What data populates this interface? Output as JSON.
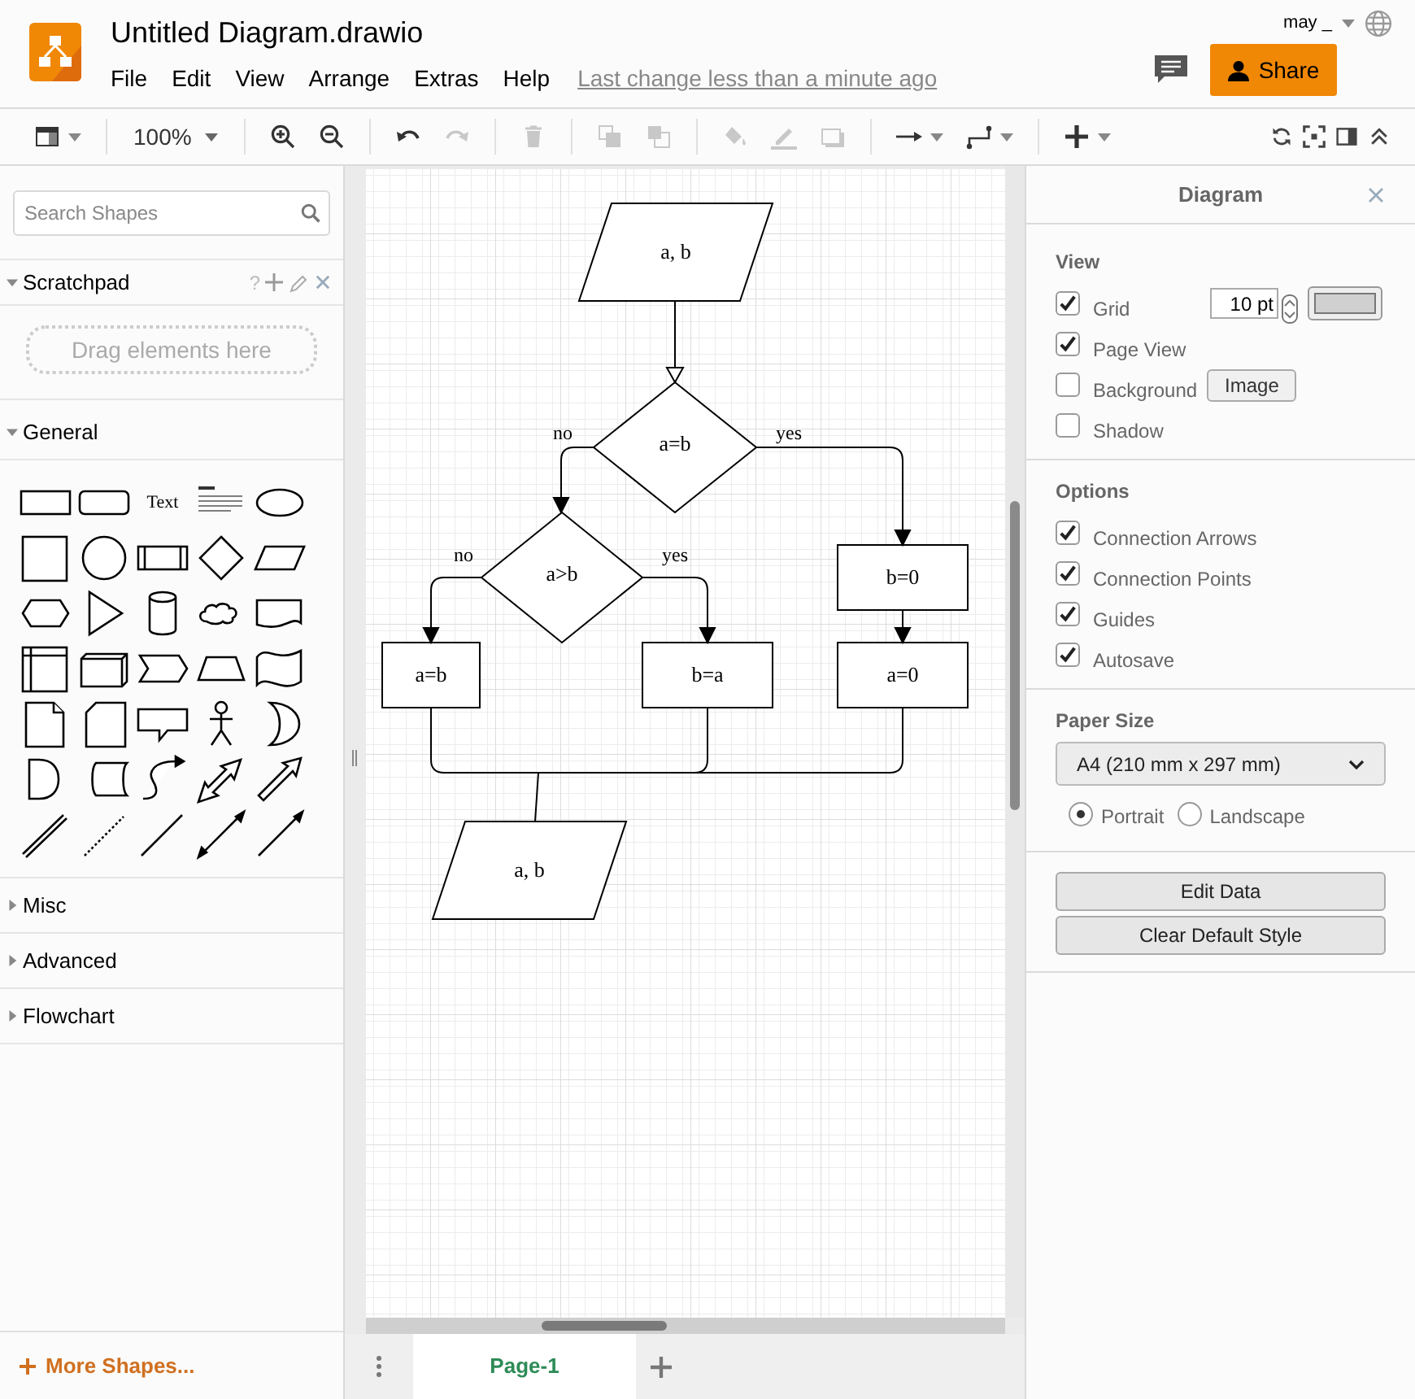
{
  "header": {
    "title": "Untitled Diagram.drawio",
    "menus": [
      "File",
      "Edit",
      "View",
      "Arrange",
      "Extras",
      "Help"
    ],
    "last_change": "Last change less than a minute ago",
    "user": "may _",
    "share": "Share"
  },
  "toolbar": {
    "groups": [
      [
        {
          "kind": "panels",
          "disabled": false
        }
      ],
      [
        {
          "kind": "zoom",
          "label": "100%",
          "disabled": false
        }
      ],
      [
        {
          "kind": "zoom-in",
          "disabled": false
        },
        {
          "kind": "zoom-out",
          "disabled": false
        }
      ],
      [
        {
          "kind": "undo",
          "disabled": false
        },
        {
          "kind": "redo",
          "disabled": true
        }
      ],
      [
        {
          "kind": "delete",
          "disabled": true
        }
      ],
      [
        {
          "kind": "to-front",
          "disabled": true
        },
        {
          "kind": "to-back",
          "disabled": true
        }
      ],
      [
        {
          "kind": "fill",
          "disabled": true
        },
        {
          "kind": "line-color",
          "disabled": true
        },
        {
          "kind": "shadow",
          "disabled": true
        }
      ],
      [
        {
          "kind": "connection",
          "disabled": false
        },
        {
          "kind": "waypoints",
          "disabled": false
        }
      ],
      [
        {
          "kind": "insert",
          "disabled": false
        }
      ]
    ],
    "right": [
      {
        "kind": "sync"
      },
      {
        "kind": "fullscreen"
      },
      {
        "kind": "format-panel"
      },
      {
        "kind": "collapse"
      }
    ]
  },
  "sidebar": {
    "search": {
      "placeholder": "Search Shapes"
    },
    "scratchpad": {
      "title": "Scratchpad",
      "expanded": true,
      "help": "?",
      "drop_hint": "Drag elements here"
    },
    "sections": [
      {
        "title": "General",
        "expanded": true,
        "shapes": [
          {
            "kind": "rectangle"
          },
          {
            "kind": "rounded-rectangle"
          },
          {
            "kind": "text",
            "label": "Text"
          },
          {
            "kind": "heading"
          },
          {
            "kind": "ellipse"
          },
          {
            "kind": "square"
          },
          {
            "kind": "circle"
          },
          {
            "kind": "process"
          },
          {
            "kind": "diamond"
          },
          {
            "kind": "parallelogram"
          },
          {
            "kind": "hexagon"
          },
          {
            "kind": "triangle"
          },
          {
            "kind": "cylinder"
          },
          {
            "kind": "cloud"
          },
          {
            "kind": "document"
          },
          {
            "kind": "internal-storage"
          },
          {
            "kind": "cube"
          },
          {
            "kind": "step"
          },
          {
            "kind": "trapezoid"
          },
          {
            "kind": "tape"
          },
          {
            "kind": "note"
          },
          {
            "kind": "card"
          },
          {
            "kind": "callout"
          },
          {
            "kind": "actor"
          },
          {
            "kind": "crescent"
          },
          {
            "kind": "delay"
          },
          {
            "kind": "data-storage"
          },
          {
            "kind": "curved-arrow"
          },
          {
            "kind": "double-arrow"
          },
          {
            "kind": "arrow"
          },
          {
            "kind": "link"
          },
          {
            "kind": "dashed-line"
          },
          {
            "kind": "line"
          },
          {
            "kind": "bidirectional-connector"
          },
          {
            "kind": "directional-connector"
          }
        ]
      },
      {
        "title": "Misc",
        "expanded": false
      },
      {
        "title": "Advanced",
        "expanded": false
      },
      {
        "title": "Flowchart",
        "expanded": false
      }
    ],
    "more_shapes": "More Shapes..."
  },
  "diagram": {
    "nodes": [
      {
        "kind": "data",
        "label": "a, b"
      },
      {
        "kind": "decision",
        "label": "a=b"
      },
      {
        "kind": "decision",
        "label": "a>b"
      },
      {
        "kind": "process",
        "label": "b=0"
      },
      {
        "kind": "process",
        "label": "a=b"
      },
      {
        "kind": "process",
        "label": "b=a"
      },
      {
        "kind": "process",
        "label": "a=0"
      },
      {
        "kind": "data",
        "label": "a, b"
      }
    ],
    "edge_labels": [
      "no",
      "yes",
      "no",
      "yes"
    ]
  },
  "pages": [
    {
      "label": "Page-1",
      "selected": true
    }
  ],
  "format_panel": {
    "title": "Diagram",
    "view": {
      "heading": "View",
      "options": [
        {
          "label": "Grid",
          "checked": true,
          "kind": "grid",
          "size": "10 pt"
        },
        {
          "label": "Page View",
          "checked": true,
          "kind": "plain"
        },
        {
          "label": "Background",
          "checked": false,
          "kind": "image",
          "button": "Image"
        },
        {
          "label": "Shadow",
          "checked": false,
          "kind": "plain"
        }
      ]
    },
    "options": {
      "heading": "Options",
      "items": [
        {
          "label": "Connection Arrows",
          "checked": true
        },
        {
          "label": "Connection Points",
          "checked": true
        },
        {
          "label": "Guides",
          "checked": true
        },
        {
          "label": "Autosave",
          "checked": true
        }
      ]
    },
    "paper": {
      "heading": "Paper Size",
      "value": "A4 (210 mm x 297 mm)",
      "orientations": [
        {
          "label": "Portrait",
          "selected": true
        },
        {
          "label": "Landscape",
          "selected": false
        }
      ]
    },
    "buttons": [
      "Edit Data",
      "Clear Default Style"
    ]
  }
}
